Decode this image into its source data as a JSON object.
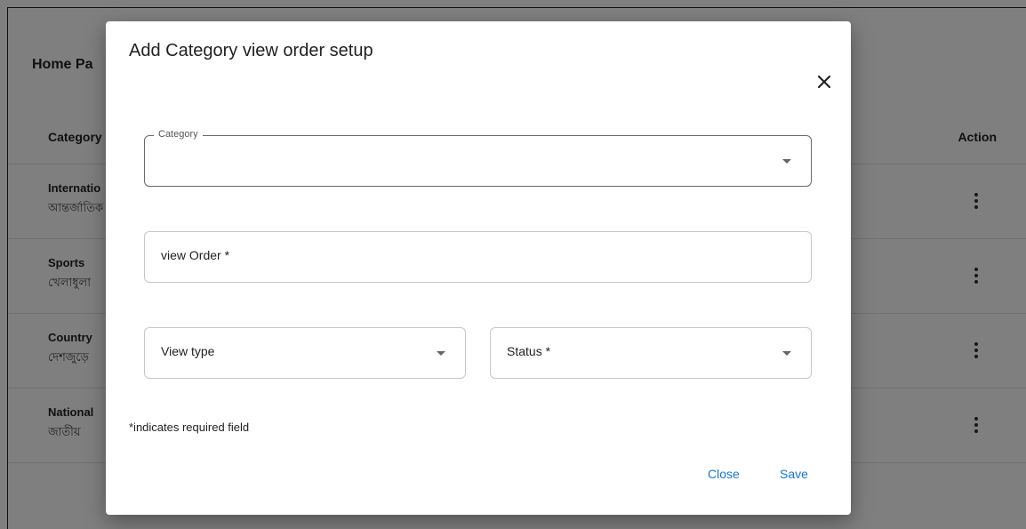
{
  "background": {
    "page_title": "Home Pa",
    "table": {
      "header_category": "Category",
      "header_action": "Action",
      "rows": [
        {
          "name": "Internatio",
          "local": "আন্তর্জাতিক"
        },
        {
          "name": "Sports",
          "local": "খেলাধুলা"
        },
        {
          "name": "Country",
          "local": "দেশজুড়ে"
        },
        {
          "name": "National",
          "local": "জাতীয়"
        }
      ]
    }
  },
  "dialog": {
    "title": "Add Category view order setup",
    "close_icon": "close-icon",
    "category_field": {
      "legend": "Category",
      "value": ""
    },
    "view_order_field": {
      "label": "view Order *"
    },
    "view_type_field": {
      "label": "View type"
    },
    "status_field": {
      "label": "Status *"
    },
    "required_note": "*indicates required field",
    "close_label": "Close",
    "save_label": "Save"
  },
  "colors": {
    "accent": "#1976d2",
    "overlay": "rgba(0,0,0,0.5)"
  }
}
